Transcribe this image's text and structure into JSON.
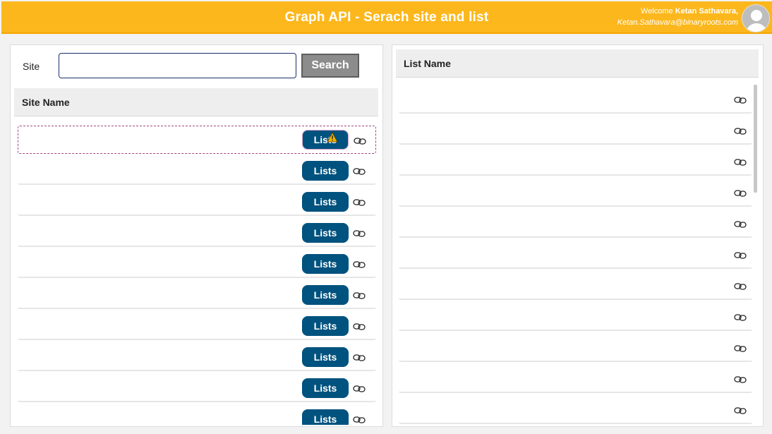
{
  "header": {
    "title": "Graph API - Serach site and list",
    "welcome_prefix": "Welcome",
    "user_name": "Ketan Sathavara,",
    "user_email": "Ketan.Sathavara@binaryroots.com"
  },
  "search": {
    "label": "Site",
    "value": "",
    "button_label": "Search"
  },
  "sites": {
    "column_header": "Site Name",
    "button_label": "Lists",
    "rows": [
      {
        "name": "",
        "selected": true
      },
      {
        "name": ""
      },
      {
        "name": ""
      },
      {
        "name": ""
      },
      {
        "name": ""
      },
      {
        "name": ""
      },
      {
        "name": ""
      },
      {
        "name": ""
      },
      {
        "name": ""
      },
      {
        "name": ""
      }
    ]
  },
  "lists": {
    "column_header": "List Name",
    "rows": [
      {
        "name": ""
      },
      {
        "name": ""
      },
      {
        "name": ""
      },
      {
        "name": ""
      },
      {
        "name": ""
      },
      {
        "name": ""
      },
      {
        "name": ""
      },
      {
        "name": ""
      },
      {
        "name": ""
      },
      {
        "name": ""
      },
      {
        "name": ""
      }
    ]
  },
  "colors": {
    "header_bg": "#fcb71c",
    "lists_button": "#00527f",
    "search_button": "#8c8c8c"
  },
  "icons": {
    "row_link": "link-icon",
    "warning": "warning-icon",
    "avatar": "user-avatar-icon"
  }
}
